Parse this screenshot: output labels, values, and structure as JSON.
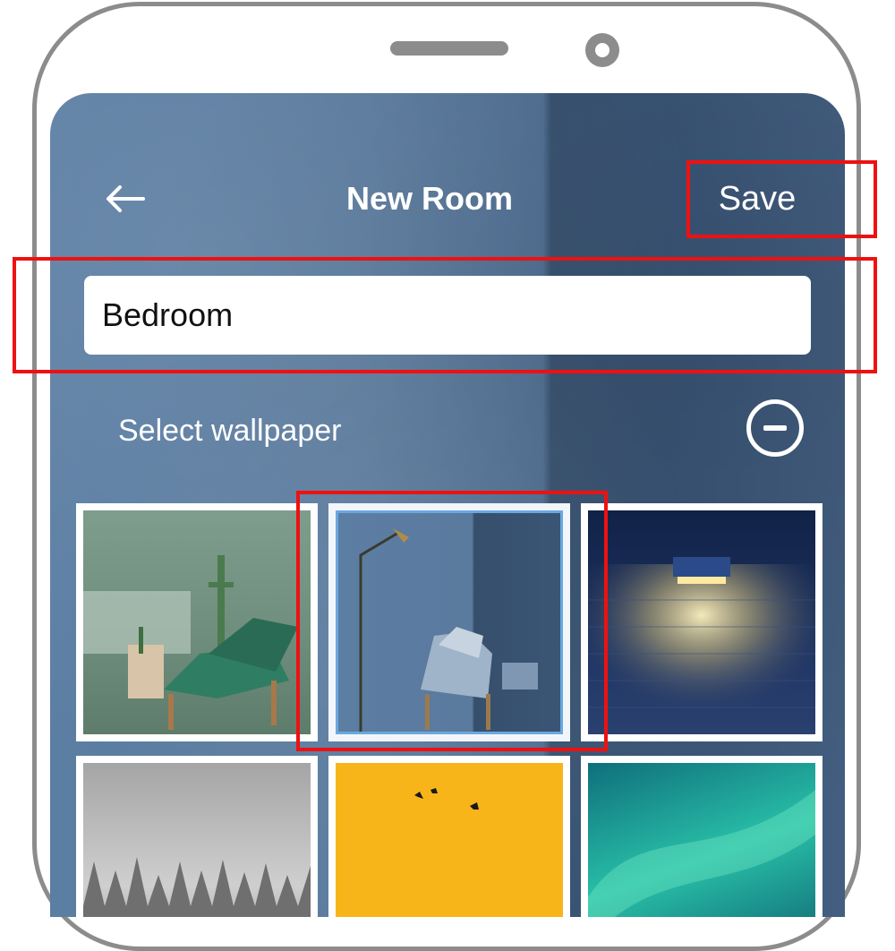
{
  "header": {
    "back_icon": "arrow-left-icon",
    "title": "New Room",
    "save_label": "Save"
  },
  "room_name_input": {
    "value": "Bedroom"
  },
  "wallpaper_section": {
    "label": "Select wallpaper",
    "toggle_icon": "minus-circle-icon"
  },
  "wallpapers": [
    {
      "subject": "green-armchair-with-cactus",
      "selected": false
    },
    {
      "subject": "blue-armchair-with-floor-lamp",
      "selected": true
    },
    {
      "subject": "blue-brick-wall-with-lamp",
      "selected": false
    },
    {
      "subject": "foggy-forest",
      "selected": false
    },
    {
      "subject": "yellow-sky-with-birds",
      "selected": false
    },
    {
      "subject": "green-aurora",
      "selected": false
    }
  ],
  "colors": {
    "highlight": "#ee1111",
    "selected_border": "#6aa8e0",
    "background_blue": "#58799d"
  }
}
